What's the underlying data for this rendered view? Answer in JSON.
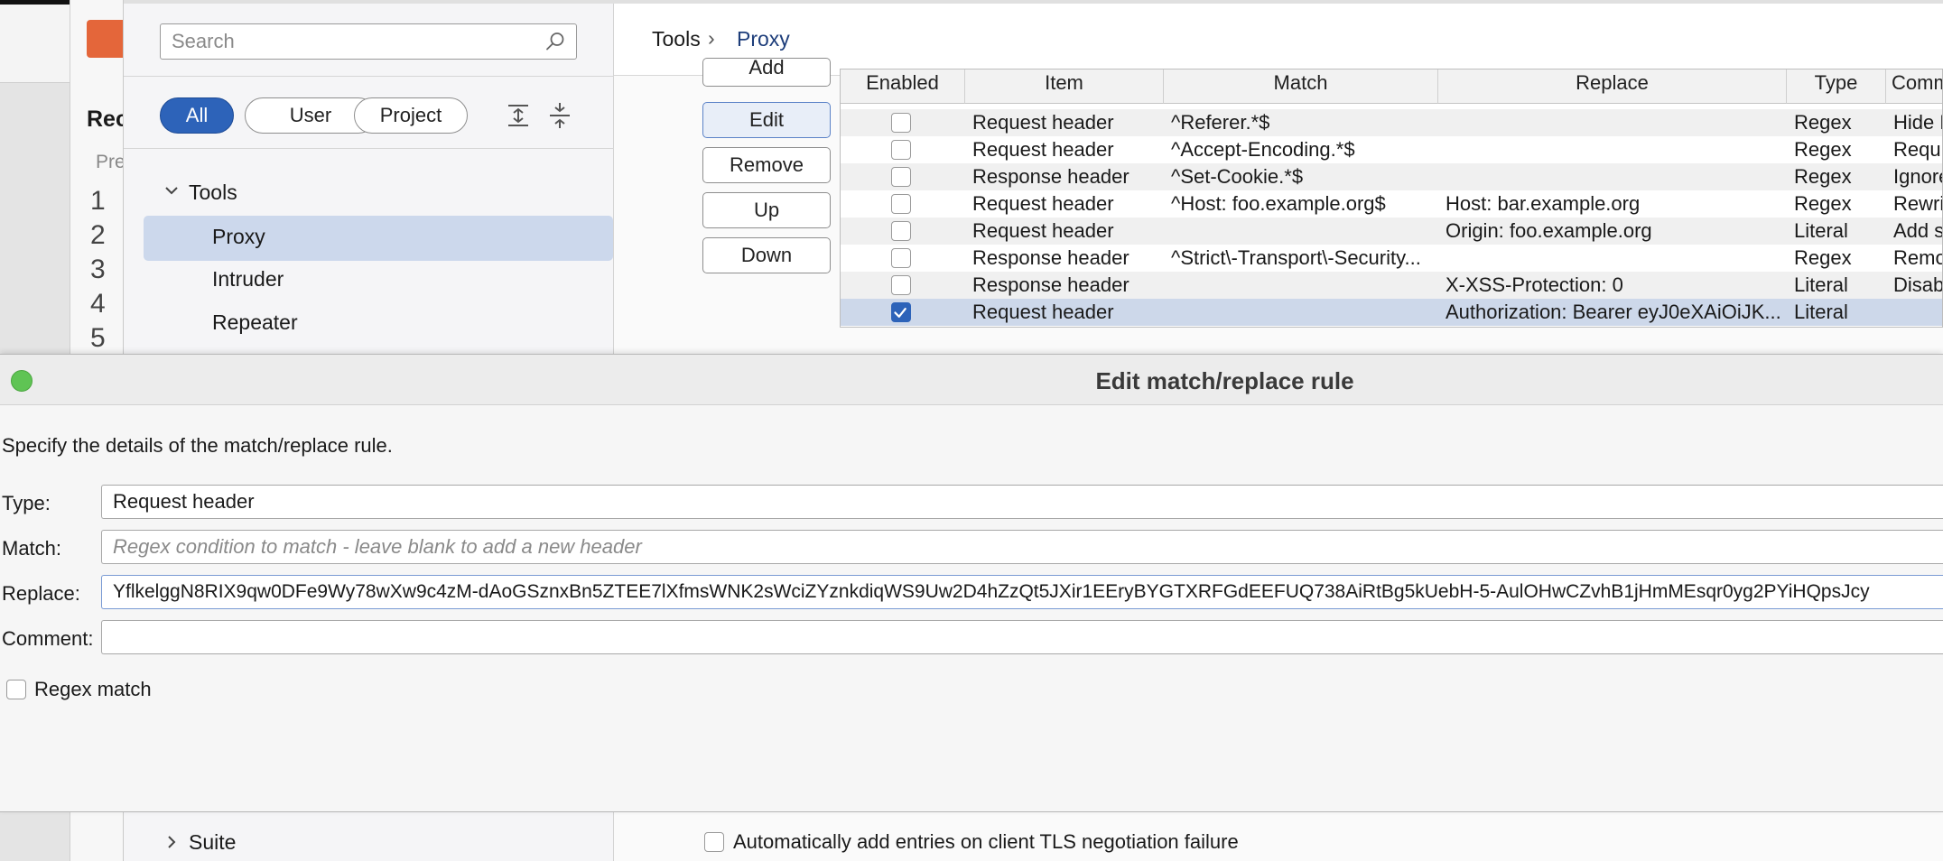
{
  "background_editor": {
    "heading_fragment": "Rec",
    "pretty_fragment": "Pre",
    "line_numbers": [
      "1",
      "2",
      "3",
      "4",
      "5"
    ]
  },
  "sidebar": {
    "search_placeholder": "Search",
    "filters": [
      "All",
      "User",
      "Project"
    ],
    "active_filter": "All",
    "tree": {
      "tools_label": "Tools",
      "tools_items": [
        "Proxy",
        "Intruder",
        "Repeater"
      ],
      "selected_item": "Proxy",
      "suite_label": "Suite"
    }
  },
  "breadcrumb": {
    "root": "Tools",
    "separator": "›",
    "current": "Proxy"
  },
  "actions": {
    "add": "Add",
    "edit": "Edit",
    "remove": "Remove",
    "up": "Up",
    "down": "Down"
  },
  "table": {
    "columns": [
      "Enabled",
      "Item",
      "Match",
      "Replace",
      "Type",
      "Comment"
    ],
    "rows": [
      {
        "enabled": false,
        "item": "Request header",
        "match": "^Referer.*$",
        "replace": "",
        "type": "Regex",
        "comment": "Hide R"
      },
      {
        "enabled": false,
        "item": "Request header",
        "match": "^Accept-Encoding.*$",
        "replace": "",
        "type": "Regex",
        "comment": "Requi"
      },
      {
        "enabled": false,
        "item": "Response header",
        "match": "^Set-Cookie.*$",
        "replace": "",
        "type": "Regex",
        "comment": "Ignore"
      },
      {
        "enabled": false,
        "item": "Request header",
        "match": "^Host: foo.example.org$",
        "replace": "Host: bar.example.org",
        "type": "Regex",
        "comment": "Rewri"
      },
      {
        "enabled": false,
        "item": "Request header",
        "match": "",
        "replace": "Origin: foo.example.org",
        "type": "Literal",
        "comment": "Add s"
      },
      {
        "enabled": false,
        "item": "Response header",
        "match": "^Strict\\-Transport\\-Security...",
        "replace": "",
        "type": "Regex",
        "comment": "Remo"
      },
      {
        "enabled": false,
        "item": "Response header",
        "match": "",
        "replace": "X-XSS-Protection: 0",
        "type": "Literal",
        "comment": "Disab"
      },
      {
        "enabled": true,
        "item": "Request header",
        "match": "",
        "replace": "Authorization: Bearer eyJ0eXAiOiJK...",
        "type": "Literal",
        "comment": ""
      }
    ],
    "selected_row": 7
  },
  "dialog": {
    "title": "Edit match/replace rule",
    "description": "Specify the details of the match/replace rule.",
    "type_label": "Type:",
    "type_value": "Request header",
    "match_label": "Match:",
    "match_placeholder": "Regex condition to match - leave blank to add a new header",
    "replace_label": "Replace:",
    "replace_value": "YflkelggN8RIX9qw0DFe9Wy78wXw9c4zM-dAoGSznxBn5ZTEE7lXfmsWNK2sWciZYznkdiqWS9Uw2D4hZzQt5JXir1EEryBYGTXRFGdEEFUQ738AiRtBg5kUebH-5-AulOHwCZvhB1jHmMEsqr0yg2PYiHQpsJcy",
    "comment_label": "Comment:",
    "comment_value": "",
    "regex_label": "Regex match",
    "regex_checked": false
  },
  "footer": {
    "tls_checkbox_label": "Automatically add entries on client TLS negotiation failure"
  },
  "colors": {
    "accent": "#2d63b9",
    "selection": "#ccd8ec",
    "brand_orange": "#e4663a",
    "traffic_green": "#5fc454"
  }
}
